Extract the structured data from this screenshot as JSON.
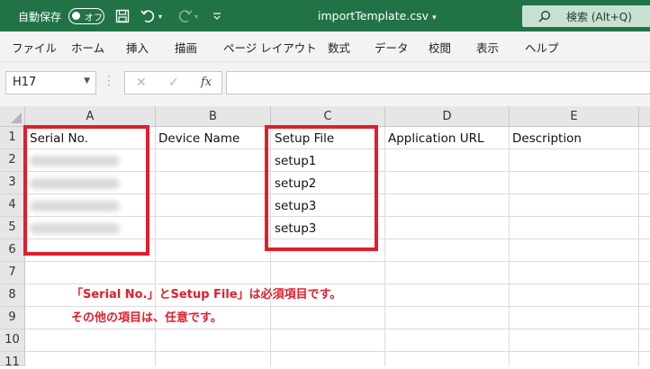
{
  "titlebar": {
    "autosave_label": "自動保存",
    "toggle_text": "オフ",
    "filename": "importTemplate.csv",
    "search_text": "検索 (Alt+Q)"
  },
  "ribbon": {
    "tabs": [
      "ファイル",
      "ホーム",
      "挿入",
      "描画",
      "ページ レイアウト",
      "数式",
      "データ",
      "校閲",
      "表示",
      "ヘルプ"
    ]
  },
  "formula_bar": {
    "name_box": "H17",
    "fx_label": "fx",
    "formula": ""
  },
  "grid": {
    "columns": [
      "A",
      "B",
      "C",
      "D",
      "E"
    ],
    "rows": [
      "1",
      "2",
      "3",
      "4",
      "5",
      "6",
      "7",
      "8",
      "9",
      "10",
      "11"
    ],
    "header_row": {
      "A": "Serial No.",
      "B": "Device Name",
      "C": "Setup File",
      "D": "Application URL",
      "E": "Description"
    },
    "setup_files": [
      "setup1",
      "setup2",
      "setup3",
      "setup3"
    ]
  },
  "annotation": {
    "line1": "「Serial No.」とSetup File」は必須項目です。",
    "line2": "その他の項目は、任意です。",
    "color": "#e01e2c"
  },
  "colors": {
    "titlebar": "#217346",
    "search_bg": "#c7e0cf"
  }
}
